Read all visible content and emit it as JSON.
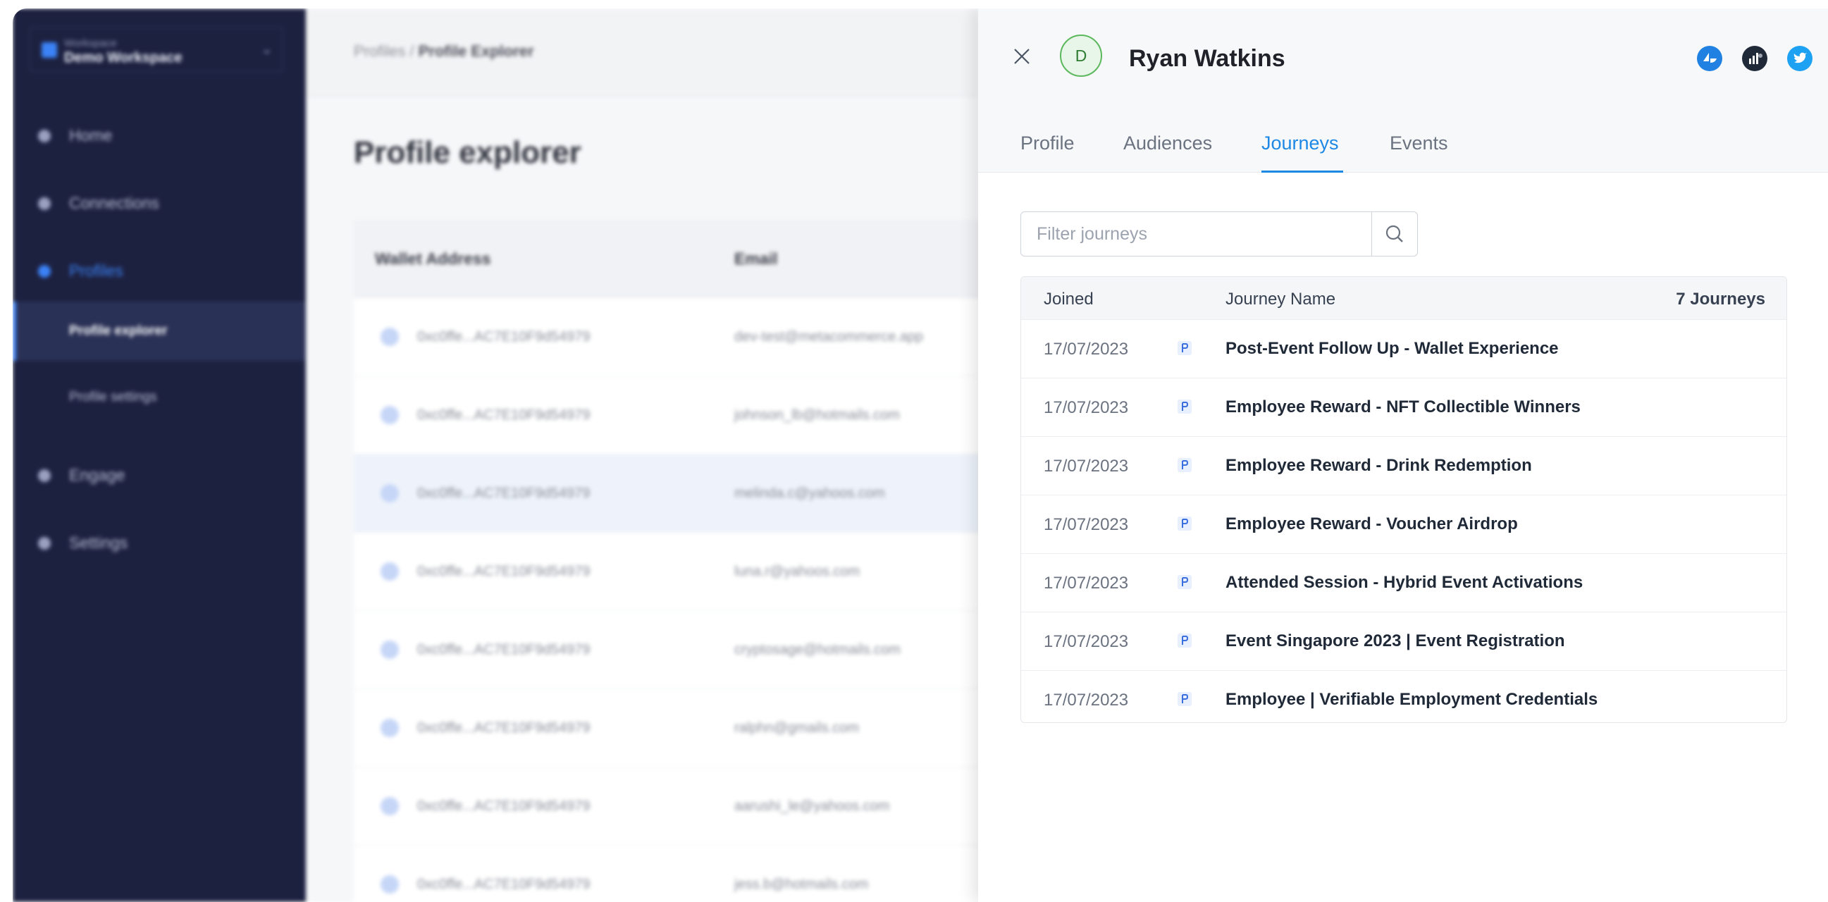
{
  "sidebar": {
    "workspace_label": "Workspace",
    "workspace_name": "Demo Workspace",
    "items": [
      {
        "label": "Home"
      },
      {
        "label": "Connections"
      },
      {
        "label": "Profiles"
      },
      {
        "label": "Profile explorer"
      },
      {
        "label": "Profile settings"
      },
      {
        "label": "Engage"
      },
      {
        "label": "Settings"
      }
    ]
  },
  "header": {
    "breadcrumb_root": "Profiles /",
    "breadcrumb_current": "Profile Explorer",
    "page_title": "Profile explorer"
  },
  "background_table": {
    "columns": [
      "Wallet Address",
      "Email"
    ],
    "rows": [
      {
        "wallet": "0xc0ffe...AC7E10F9d54979",
        "email": "dev-test@metacommerce.app"
      },
      {
        "wallet": "0xc0ffe...AC7E10F9d54979",
        "email": "johnson_lb@hotmails.com"
      },
      {
        "wallet": "0xc0ffe...AC7E10F9d54979",
        "email": "melinda.c@yahoos.com"
      },
      {
        "wallet": "0xc0ffe...AC7E10F9d54979",
        "email": "luna.r@yahoos.com"
      },
      {
        "wallet": "0xc0ffe...AC7E10F9d54979",
        "email": "cryptosage@hotmails.com"
      },
      {
        "wallet": "0xc0ffe...AC7E10F9d54979",
        "email": "ralphn@gmails.com"
      },
      {
        "wallet": "0xc0ffe...AC7E10F9d54979",
        "email": "aarushi_le@yahoos.com"
      },
      {
        "wallet": "0xc0ffe...AC7E10F9d54979",
        "email": "jess.b@hotmails.com"
      }
    ]
  },
  "drawer": {
    "avatar_initial": "D",
    "name": "Ryan Watkins",
    "social_icons": [
      "opensea-icon",
      "analytics-icon",
      "twitter-icon"
    ],
    "tabs": [
      {
        "label": "Profile"
      },
      {
        "label": "Audiences"
      },
      {
        "label": "Journeys"
      },
      {
        "label": "Events"
      }
    ],
    "active_tab": "Journeys",
    "filter_placeholder": "Filter journeys",
    "journeys_table": {
      "col_joined": "Joined",
      "col_name": "Journey Name",
      "count": "7 Journeys",
      "rows": [
        {
          "joined": "17/07/2023",
          "name": "Post-Event Follow Up - Wallet Experience"
        },
        {
          "joined": "17/07/2023",
          "name": "Employee Reward - NFT Collectible Winners"
        },
        {
          "joined": "17/07/2023",
          "name": "Employee Reward - Drink Redemption"
        },
        {
          "joined": "17/07/2023",
          "name": "Employee Reward - Voucher Airdrop"
        },
        {
          "joined": "17/07/2023",
          "name": "Attended Session - Hybrid Event Activations"
        },
        {
          "joined": "17/07/2023",
          "name": "Event Singapore 2023 | Event Registration"
        },
        {
          "joined": "17/07/2023",
          "name": "Employee | Verifiable Employment Credentials"
        }
      ]
    }
  },
  "colors": {
    "sidebar_bg": "#1d2140",
    "accent": "#1e88e5",
    "avatar_border": "#5cb85c"
  }
}
